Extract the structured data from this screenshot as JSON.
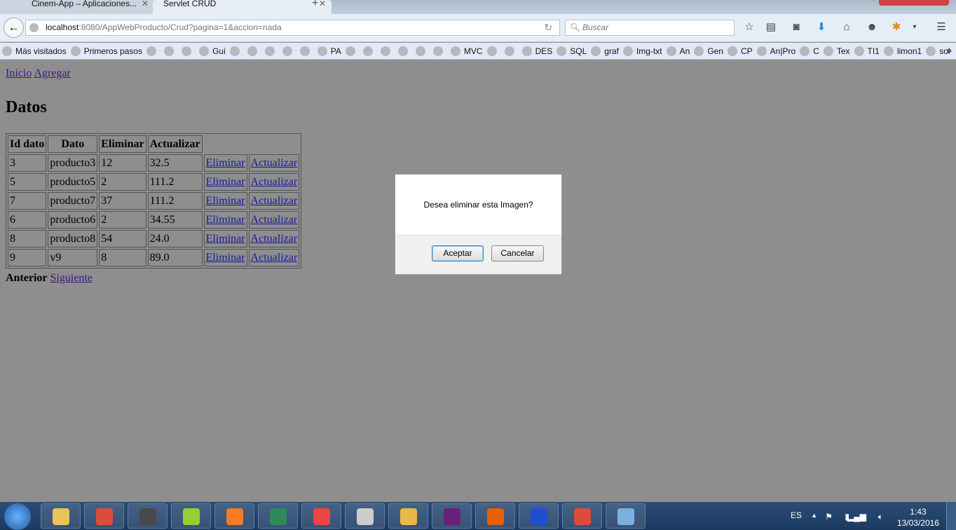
{
  "browser": {
    "tabs": [
      {
        "label": "Cinem-App – Aplicaciones...",
        "active": false
      },
      {
        "label": "Servlet CRUD",
        "active": true
      }
    ],
    "url_host": "localhost",
    "url_rest": ":8080/AppWebProducto/Crud?pagina=1&accion=nada",
    "search_placeholder": "Buscar",
    "bookmarks": [
      {
        "label": "Más visitados"
      },
      {
        "label": "Primeros pasos"
      },
      {
        "label": ""
      },
      {
        "label": ""
      },
      {
        "label": ""
      },
      {
        "label": "Gui"
      },
      {
        "label": ""
      },
      {
        "label": ""
      },
      {
        "label": ""
      },
      {
        "label": ""
      },
      {
        "label": ""
      },
      {
        "label": "PA"
      },
      {
        "label": ""
      },
      {
        "label": ""
      },
      {
        "label": ""
      },
      {
        "label": ""
      },
      {
        "label": ""
      },
      {
        "label": ""
      },
      {
        "label": "MVC"
      },
      {
        "label": ""
      },
      {
        "label": ""
      },
      {
        "label": "DES"
      },
      {
        "label": "SQL"
      },
      {
        "label": "graf"
      },
      {
        "label": "Img-txt"
      },
      {
        "label": "An"
      },
      {
        "label": "Gen"
      },
      {
        "label": "CP"
      },
      {
        "label": "An|Pro"
      },
      {
        "label": "C"
      },
      {
        "label": "Tex"
      },
      {
        "label": "TI1"
      },
      {
        "label": "limon1"
      },
      {
        "label": "sol"
      }
    ],
    "bookmarks_more": "»"
  },
  "page": {
    "links": {
      "inicio": "Inicio",
      "agregar": "Agregar"
    },
    "title": "Datos",
    "table": {
      "headers": [
        "Id dato",
        "Dato",
        "Eliminar",
        "Actualizar"
      ],
      "rows": [
        [
          "3",
          "producto3",
          "12",
          "32.5",
          "Eliminar",
          "Actualizar"
        ],
        [
          "5",
          "producto5",
          "2",
          "111.2",
          "Eliminar",
          "Actualizar"
        ],
        [
          "7",
          "producto7",
          "37",
          "111.2",
          "Eliminar",
          "Actualizar"
        ],
        [
          "6",
          "producto6",
          "2",
          "34.55",
          "Eliminar",
          "Actualizar"
        ],
        [
          "8",
          "producto8",
          "54",
          "24.0",
          "Eliminar",
          "Actualizar"
        ],
        [
          "9",
          "v9",
          "8",
          "89.0",
          "Eliminar",
          "Actualizar"
        ]
      ]
    },
    "pager": {
      "prev": "Anterior",
      "next": "Siguiente"
    }
  },
  "dialog": {
    "message": "Desea eliminar esta Imagen?",
    "ok": "Aceptar",
    "cancel": "Cancelar"
  },
  "taskbar": {
    "apps": [
      {
        "name": "explorer",
        "color": "#e8c25a"
      },
      {
        "name": "chrome",
        "color": "#dd4b39"
      },
      {
        "name": "sublime",
        "color": "#4a4a4a"
      },
      {
        "name": "notepad",
        "color": "#9acd32"
      },
      {
        "name": "xampp",
        "color": "#fb7a24"
      },
      {
        "name": "terminal",
        "color": "#2e8b57"
      },
      {
        "name": "apps",
        "color": "#e44"
      },
      {
        "name": "snipping",
        "color": "#ccc"
      },
      {
        "name": "tools",
        "color": "#e8b84a"
      },
      {
        "name": "visual-studio",
        "color": "#68217a"
      },
      {
        "name": "firefox",
        "color": "#e66000"
      },
      {
        "name": "q-app",
        "color": "#1e4fd0"
      },
      {
        "name": "chrome2",
        "color": "#dd4b39"
      },
      {
        "name": "virtualbox",
        "color": "#7ab0e0"
      }
    ],
    "language": "ES",
    "time": "1:43",
    "date": "13/03/2016"
  }
}
